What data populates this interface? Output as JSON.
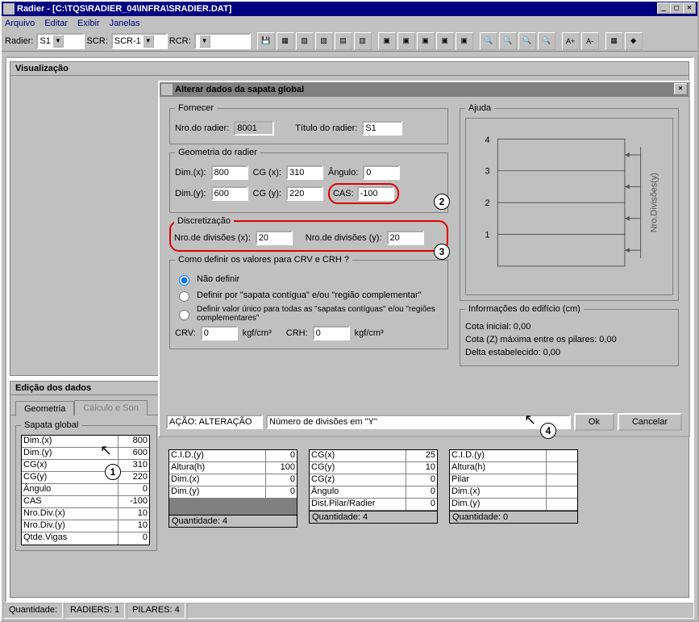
{
  "window": {
    "title": "Radier -",
    "path": "[C:\\TQS\\RADIER_04\\INFRA\\SRADIER.DAT]"
  },
  "menu": {
    "items": [
      "Arquivo",
      "Editar",
      "Exibir",
      "Janelas"
    ]
  },
  "toolbar": {
    "radier_label": "Radier:",
    "radier_value": "S1",
    "scr_label": "SCR:",
    "scr_value": "SCR-1",
    "rcr_label": "RCR:",
    "rcr_value": ""
  },
  "viz": {
    "title": "Visualização"
  },
  "dialog": {
    "title": "Alterar dados da sapata global",
    "fornecer": {
      "legend": "Fornecer",
      "nro_label": "Nro.do radier:",
      "nro_value": "8001",
      "titulo_label": "Título do radier:",
      "titulo_value": "S1"
    },
    "geom": {
      "legend": "Geometria do radier",
      "dimx_label": "Dim.(x):",
      "dimx": "800",
      "cgx_label": "CG (x):",
      "cgx": "310",
      "ang_label": "Ângulo:",
      "ang": "0",
      "dimy_label": "Dim.(y):",
      "dimy": "600",
      "cgy_label": "CG (y):",
      "cgy": "220",
      "cas_label": "CAS:",
      "cas": "-100"
    },
    "disc": {
      "legend": "Discretização",
      "ndivx_label": "Nro.de divisões (x):",
      "ndivx": "20",
      "ndivy_label": "Nro.de divisões (y):",
      "ndivy": "20"
    },
    "crvcrh": {
      "legend": "Como definir os valores para CRV e CRH ?",
      "opt1": "Não definir",
      "opt2": "Definir por \"sapata contígua\" e/ou \"região complementar\"",
      "opt3": "Definir valor único para todas as \"sapatas contíguas\" e/ou \"regiões complementares\"",
      "crv_label": "CRV:",
      "crv": "0",
      "crv_unit": "kgf/cm³",
      "crh_label": "CRH:",
      "crh": "0",
      "crh_unit": "kgf/cm³"
    },
    "ajuda": {
      "legend": "Ajuda",
      "ylabel": "Nro.Divisões(y)"
    },
    "info": {
      "legend": "Informações do edifício (cm)",
      "cota_ini": "Cota inicial: 0,00",
      "cota_z": "Cota (Z) máxima entre os pilares: 0,00",
      "delta": "Delta estabelecido: 0,00"
    },
    "action_label": "AÇÃO: ALTERAÇÃO",
    "action_desc": "Número de divisões em \"Y\"",
    "ok": "Ok",
    "cancel": "Cancelar"
  },
  "edit": {
    "title": "Edição dos dados",
    "tab1": "Geometria",
    "tab2": "Cálculo e Son",
    "sapata": {
      "legend": "Sapata global",
      "rows": [
        {
          "l": "Dim.(x)",
          "v": "800"
        },
        {
          "l": "Dim.(y)",
          "v": "600"
        },
        {
          "l": "CG(x)",
          "v": "310"
        },
        {
          "l": "CG(y)",
          "v": "220"
        },
        {
          "l": "Ângulo",
          "v": "0"
        },
        {
          "l": "CAS",
          "v": "-100"
        },
        {
          "l": "Nro.Div.(x)",
          "v": "10"
        },
        {
          "l": "Nro.Div.(y)",
          "v": "10"
        },
        {
          "l": "Qtde.Vigas",
          "v": "0"
        }
      ]
    },
    "col2": {
      "rows": [
        {
          "l": "C.I.D.(y)",
          "v": "0"
        },
        {
          "l": "Altura(h)",
          "v": "100"
        },
        {
          "l": "Dim.(x)",
          "v": "0"
        },
        {
          "l": "Dim.(y)",
          "v": "0"
        }
      ],
      "footer": "Quantidade: 4"
    },
    "col3": {
      "rows": [
        {
          "l": "CG(x)",
          "v": "25"
        },
        {
          "l": "CG(y)",
          "v": "10"
        },
        {
          "l": "CG(z)",
          "v": "0"
        },
        {
          "l": "Ângulo",
          "v": "0"
        },
        {
          "l": "Dist.Pilar/Radier",
          "v": "0"
        }
      ],
      "footer": "Quantidade: 4"
    },
    "col4": {
      "rows": [
        {
          "l": "C.I.D.(y)",
          "v": ""
        },
        {
          "l": "Altura(h)",
          "v": ""
        },
        {
          "l": "Pilar",
          "v": ""
        },
        {
          "l": "Dim.(x)",
          "v": ""
        },
        {
          "l": "Dim.(y)",
          "v": ""
        }
      ],
      "footer": "Quantidade: 0"
    }
  },
  "status": {
    "qtd": "Quantidade:",
    "radiers": "RADIERS: 1",
    "pilares": "PILARES: 4"
  }
}
